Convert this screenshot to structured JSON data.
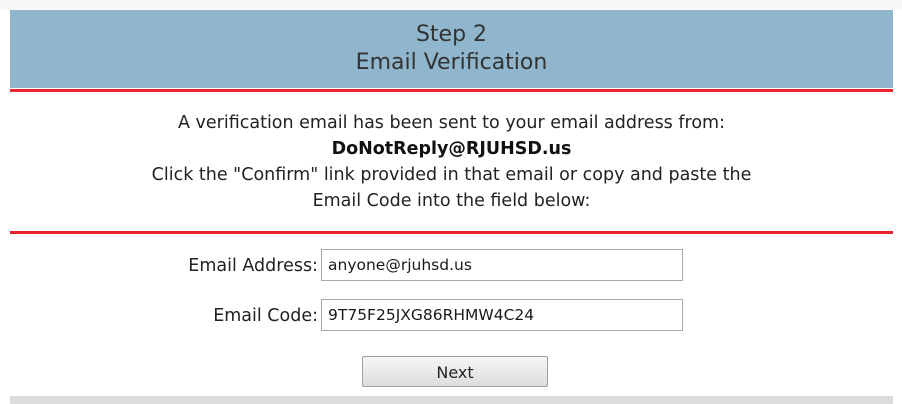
{
  "header": {
    "step": "Step 2",
    "title": "Email Verification"
  },
  "message": {
    "line1": "A verification email has been sent to your email address from:",
    "sender": "DoNotReply@RJUHSD.us",
    "line3": "Click the \"Confirm\" link provided in that email or copy and paste the",
    "line4": "Email Code into the field below:"
  },
  "form": {
    "email_label": "Email Address:",
    "email_value": "anyone@rjuhsd.us",
    "code_label": "Email Code:",
    "code_value": "9T75F25JXG86RHMW4C24",
    "next_label": "Next"
  },
  "colors": {
    "header_bg": "#8fb6cc",
    "divider": "#e8242c"
  }
}
